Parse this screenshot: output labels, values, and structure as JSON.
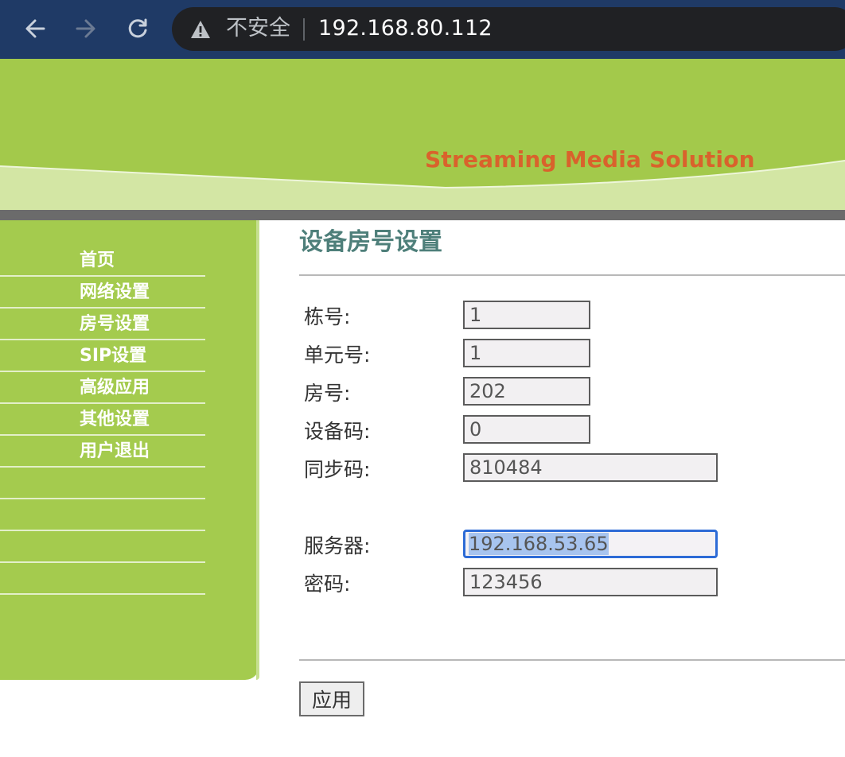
{
  "browser": {
    "security_label": "不安全",
    "url": "192.168.80.112",
    "toolbar_color": "#1f3a66"
  },
  "banner": {
    "title": "Streaming Media Solution",
    "colors": {
      "green": "#a3c94b",
      "light_green": "#d3e6a4",
      "title": "#d9622c"
    }
  },
  "sidebar": {
    "items": [
      {
        "label": "首页"
      },
      {
        "label": "网络设置"
      },
      {
        "label": "房号设置"
      },
      {
        "label": "SIP设置"
      },
      {
        "label": "高级应用"
      },
      {
        "label": "其他设置"
      },
      {
        "label": "用户退出"
      },
      {
        "label": ""
      },
      {
        "label": ""
      },
      {
        "label": ""
      },
      {
        "label": ""
      }
    ]
  },
  "main": {
    "title": "设备房号设置",
    "fields": [
      {
        "label": "栋号:",
        "value": "1"
      },
      {
        "label": "单元号:",
        "value": "1"
      },
      {
        "label": "房号:",
        "value": "202"
      },
      {
        "label": "设备码:",
        "value": "0"
      },
      {
        "label": "同步码:",
        "value": "810484"
      },
      {
        "label": "服务器:",
        "value": "192.168.53.65"
      },
      {
        "label": "密码:",
        "value": "123456"
      }
    ],
    "apply_label": "应用"
  }
}
